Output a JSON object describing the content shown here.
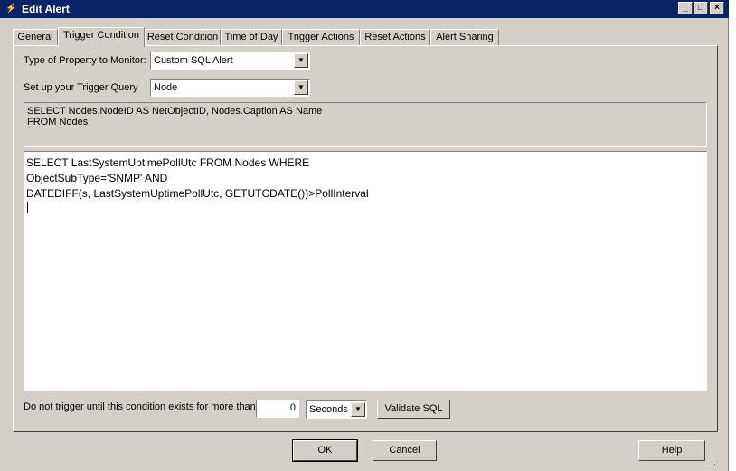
{
  "window": {
    "title": "Edit Alert",
    "icon": "app-icon",
    "controls": {
      "minimize": "_",
      "maximize": "□",
      "close": "×"
    }
  },
  "tabs": [
    {
      "label": "General"
    },
    {
      "label": "Trigger Condition"
    },
    {
      "label": "Reset Condition"
    },
    {
      "label": "Time of Day"
    },
    {
      "label": "Trigger Actions"
    },
    {
      "label": "Reset Actions"
    },
    {
      "label": "Alert Sharing"
    }
  ],
  "active_tab": "Trigger Condition",
  "trigger_condition": {
    "property_label": "Type of Property to Monitor:",
    "property_value": "Custom SQL Alert",
    "query_label": "Set up your Trigger Query",
    "query_value": "Node",
    "base_query": "SELECT Nodes.NodeID AS NetObjectID, Nodes.Caption AS Name\nFROM Nodes",
    "custom_sql": "SELECT LastSystemUptimePollUtc FROM Nodes WHERE\nObjectSubType='SNMP' AND\nDATEDIFF(s, LastSystemUptimePollUtc, GETUTCDATE())>PollInterval",
    "delay_label": "Do not trigger until this condition exists for more than",
    "delay_value": "0",
    "delay_unit": "Seconds",
    "validate_label": "Validate SQL"
  },
  "footer": {
    "ok_label": "OK",
    "cancel_label": "Cancel",
    "help_label": "Help"
  }
}
